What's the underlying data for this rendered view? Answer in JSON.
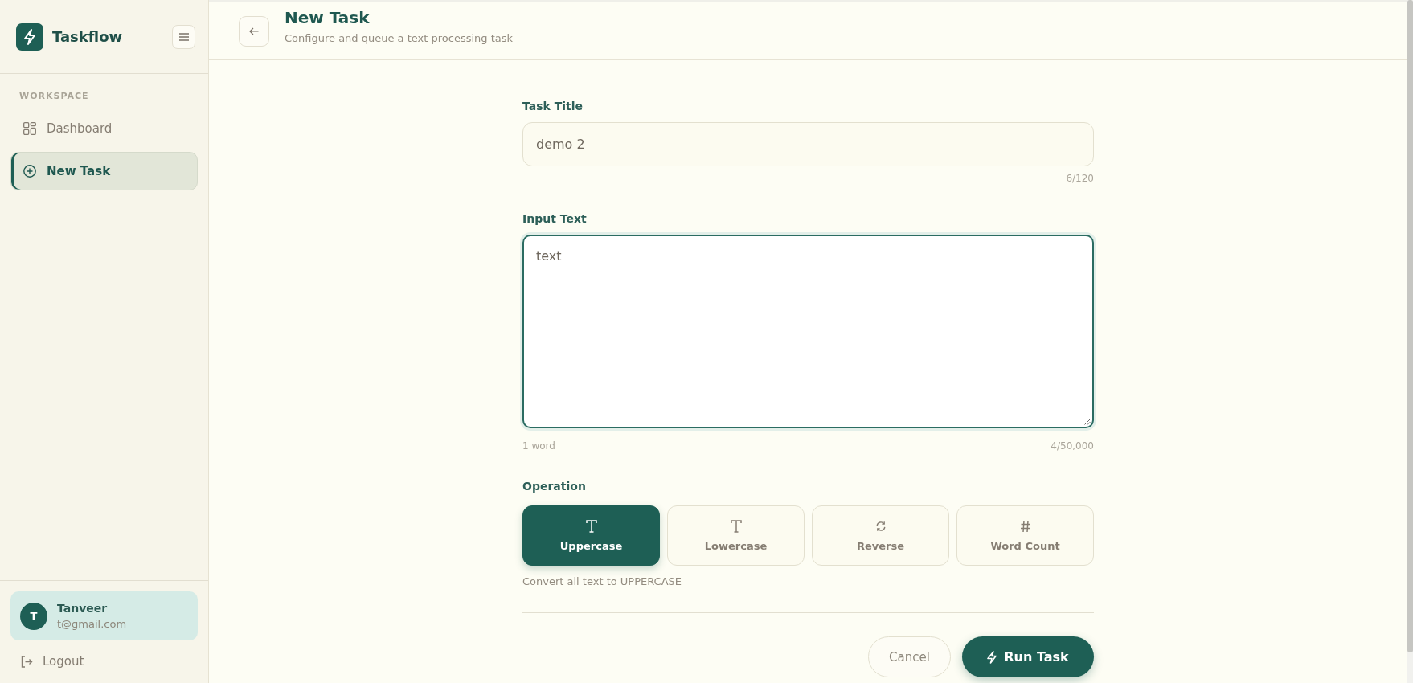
{
  "sidebar": {
    "brand": "Taskflow",
    "section_label": "WORKSPACE",
    "items": [
      {
        "label": "Dashboard",
        "kind": "dashboard",
        "selected": false
      },
      {
        "label": "New Task",
        "kind": "new",
        "selected": true
      }
    ],
    "user": {
      "initial": "T",
      "name": "Tanveer",
      "email": "t@gmail.com"
    },
    "logout": "Logout"
  },
  "header": {
    "title": "New Task",
    "subtitle": "Configure and queue a text processing task"
  },
  "form": {
    "title_field": {
      "label": "Task Title",
      "value": "demo 2",
      "counter": "6/120"
    },
    "input_text": {
      "label": "Input Text",
      "value": "text",
      "focused": true,
      "word_count": "1 word",
      "counter": "4/50,000"
    },
    "operation": {
      "label": "Operation",
      "options": [
        {
          "label": "Uppercase",
          "kind": "uppercase",
          "selected": true
        },
        {
          "label": "Lowercase",
          "kind": "lowercase",
          "selected": false
        },
        {
          "label": "Reverse",
          "kind": "reverse",
          "selected": false
        },
        {
          "label": "Word Count",
          "kind": "word_count",
          "selected": false
        }
      ],
      "description": "Convert all text to UPPERCASE"
    },
    "buttons": {
      "cancel": "Cancel",
      "run": "Run Task"
    }
  }
}
